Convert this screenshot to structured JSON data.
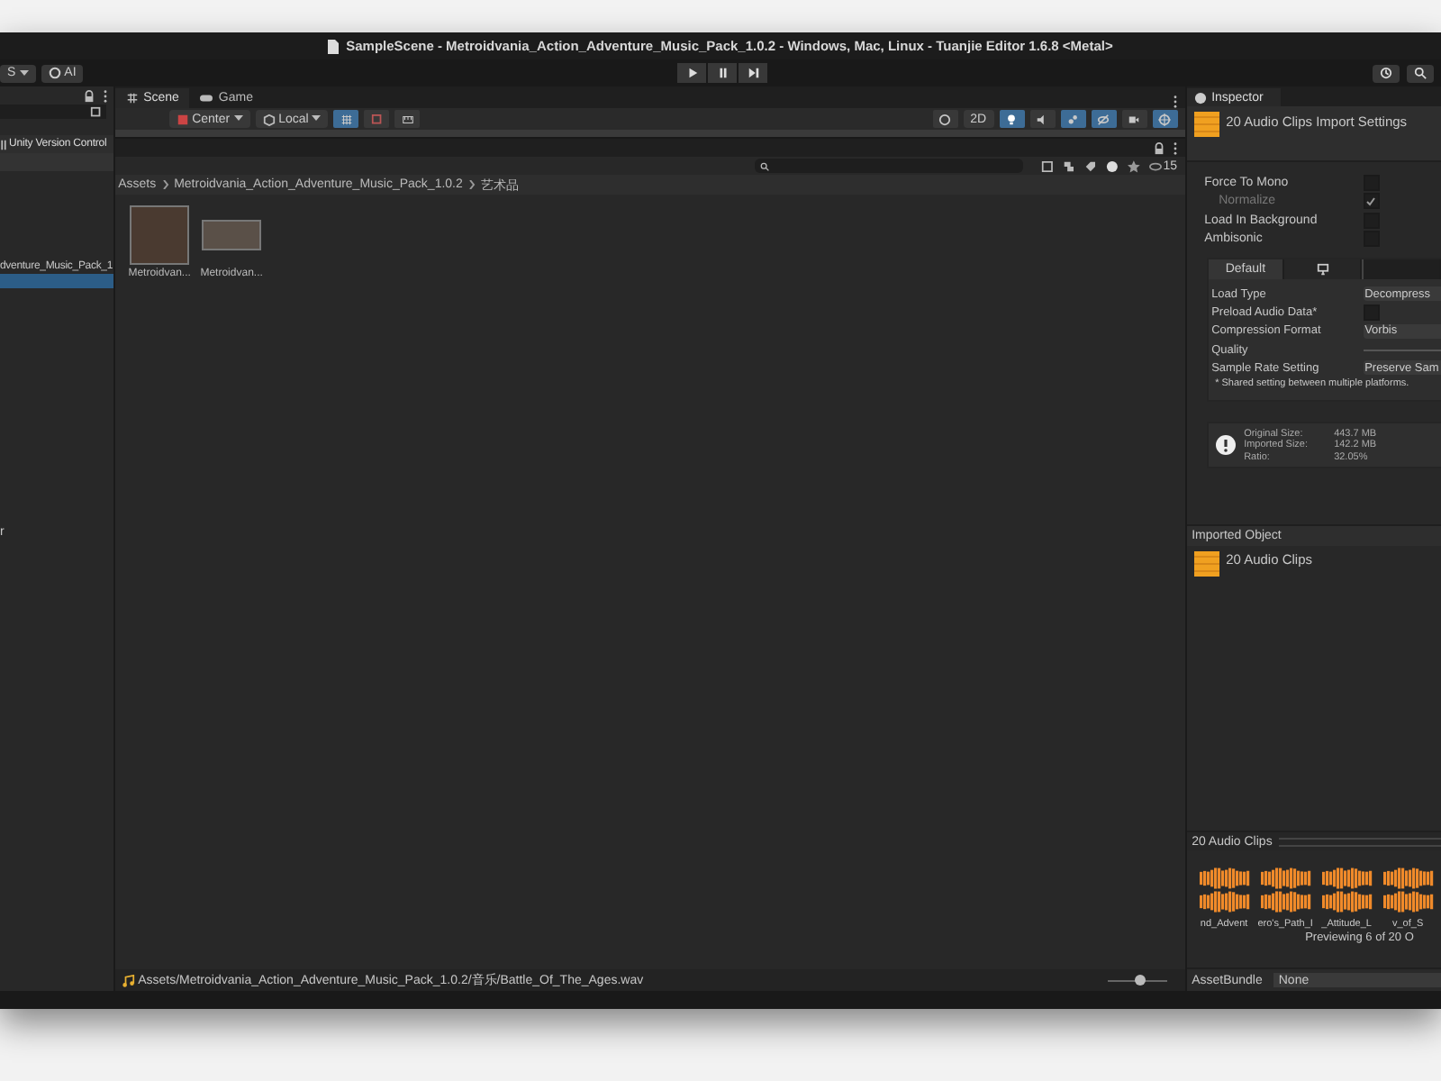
{
  "window": {
    "title": "SampleScene - Metroidvania_Action_Adventure_Music_Pack_1.0.2 - Windows, Mac, Linux - Tuanjie Editor 1.6.8 <Metal>"
  },
  "toolbar": {
    "account_menu": "S",
    "ai_button": "AI"
  },
  "scene_tabs": [
    {
      "label": "Scene",
      "selected": true
    },
    {
      "label": "Game",
      "selected": false
    }
  ],
  "scene_toolbar": {
    "pivot": "Center",
    "space": "Local",
    "view_label": "2D",
    "toggles": [
      {
        "kind": "grid",
        "on": true
      },
      {
        "kind": "snap",
        "on": false
      },
      {
        "kind": "ruler",
        "on": false
      },
      {
        "kind": "shading",
        "on": false
      },
      {
        "kind": "light",
        "on": true
      },
      {
        "kind": "audio",
        "on": false
      },
      {
        "kind": "effects",
        "on": true
      },
      {
        "kind": "hidden",
        "on": true
      },
      {
        "kind": "camera",
        "on": false
      },
      {
        "kind": "gizmos",
        "on": true
      }
    ]
  },
  "project": {
    "hidden_count": "15",
    "breadcrumb": [
      "Assets",
      "Metroidvania_Action_Adventure_Music_Pack_1.0.2",
      "艺术品"
    ],
    "assets": [
      {
        "label": "Metroidvan..."
      },
      {
        "label": "Metroidvan..."
      }
    ],
    "status_path": "Assets/Metroidvania_Action_Adventure_Music_Pack_1.0.2/音乐/Battle_Of_The_Ages.wav",
    "zoom": {
      "level": 0.55
    }
  },
  "folder_tree": {
    "tab": "Unity Version Control",
    "items": [
      {
        "label": "dventure_Music_Pack_1",
        "selected": false
      },
      {
        "selected": true
      }
    ],
    "cut_label": "r"
  },
  "inspector": {
    "tab": "Inspector",
    "title": "20 Audio Clips Import Settings",
    "options": [
      {
        "label": "Force To Mono",
        "checked": false,
        "disabled": false
      },
      {
        "label": "Normalize",
        "checked": true,
        "disabled": true
      },
      {
        "label": "Load In Background",
        "checked": false,
        "disabled": false
      },
      {
        "label": "Ambisonic",
        "checked": false,
        "disabled": false
      }
    ],
    "platform_tabs": [
      {
        "kind": "text",
        "label": "Default",
        "selected": true
      },
      {
        "kind": "monitor",
        "selected": false
      },
      {
        "kind": "blank",
        "selected": false
      }
    ],
    "fields": [
      {
        "kind": "dropdown",
        "label": "Load Type",
        "value": "Decompress"
      },
      {
        "kind": "checkbox",
        "label": "Preload Audio Data*",
        "checked": false
      },
      {
        "kind": "dropdown",
        "label": "Compression Format",
        "value": "Vorbis"
      },
      {
        "kind": "slider",
        "label": "Quality"
      },
      {
        "kind": "dropdown",
        "label": "Sample Rate Setting",
        "value": "Preserve Sam"
      }
    ],
    "note": "* Shared setting between multiple platforms.",
    "info": [
      {
        "label": "Original Size:",
        "value": "443.7 MB"
      },
      {
        "label": "Imported Size:",
        "value": "142.2 MB"
      },
      {
        "label": "Ratio:",
        "value": "32.05%"
      }
    ],
    "imported_header": "Imported Object",
    "imported_item": "20 Audio Clips",
    "preview_header": "20 Audio Clips",
    "clips": [
      "nd_Advent",
      "ero's_Path_I",
      "_Attitude_L",
      "v_of_S"
    ],
    "preview_status": "Previewing 6 of 20 O",
    "asset_bundle": {
      "label": "AssetBundle",
      "value": "None"
    }
  }
}
